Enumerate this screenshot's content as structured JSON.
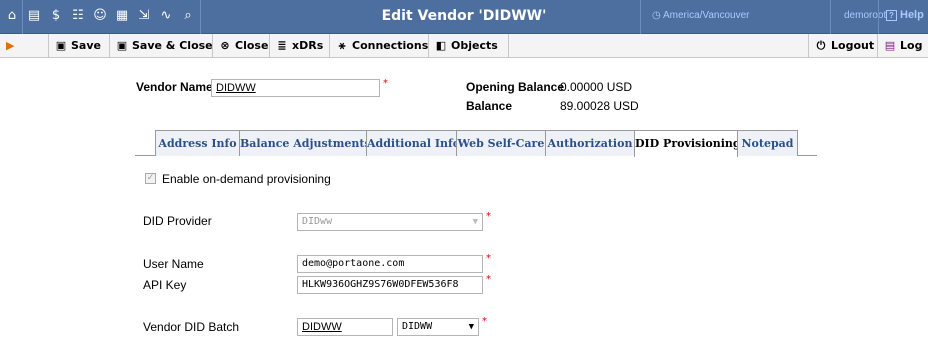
{
  "header": {
    "title": "Edit Vendor 'DIDWW'",
    "timezone": "America/Vancouver",
    "user": "demoroot",
    "help_label": "Help",
    "icons": [
      "home-icon",
      "list-icon",
      "dollar-icon",
      "accounts-icon",
      "user-icon",
      "groups-icon",
      "export-icon",
      "chart-icon",
      "search-icon"
    ]
  },
  "toolbar": {
    "save_label": "Save",
    "save_close_label": "Save & Close",
    "close_label": "Close",
    "xdrs_label": "xDRs",
    "connections_label": "Connections",
    "objects_label": "Objects",
    "logout_label": "Logout",
    "log_label": "Log"
  },
  "vendor": {
    "name_label": "Vendor Name",
    "name_value": "DIDWW",
    "opening_balance_label": "Opening Balance",
    "opening_balance_value": "0.00000 USD",
    "balance_label": "Balance",
    "balance_value": "89.00028 USD"
  },
  "tabs": [
    {
      "label": "Address Info",
      "active": false
    },
    {
      "label": "Balance Adjustments",
      "active": false
    },
    {
      "label": "Additional Info",
      "active": false
    },
    {
      "label": "Web Self-Care",
      "active": false
    },
    {
      "label": "Authorization",
      "active": false
    },
    {
      "label": "DID Provisioning",
      "active": true
    },
    {
      "label": "Notepad",
      "active": false
    }
  ],
  "provisioning": {
    "enable_label": "Enable on-demand provisioning",
    "enable_checked": true,
    "provider_label": "DID Provider",
    "provider_value": "DIDww",
    "username_label": "User Name",
    "username_value": "demo@portaone.com",
    "apikey_label": "API Key",
    "apikey_value": "HLKW936OGHZ9S76W0DFEW536F8",
    "batch_label": "Vendor DID Batch",
    "batch_value": "DIDWW",
    "batch_select_value": "DIDWW"
  },
  "colors": {
    "header_bg": "#4c6fa0",
    "tab_text": "#2d4f88",
    "required": "#e00000"
  }
}
